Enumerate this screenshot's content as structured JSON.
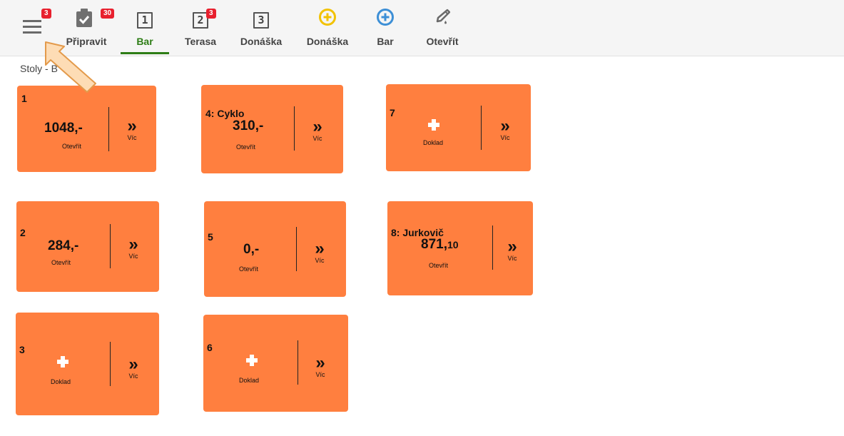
{
  "toolbar": {
    "menu_badge": "3",
    "prepare_badge": "30",
    "prepare_label": "Připravit",
    "tab1_num": "1",
    "tab1_label": "Bar",
    "tab2_num": "2",
    "tab2_badge": "3",
    "tab2_label": "Terasa",
    "tab3_num": "3",
    "tab3_label": "Donáška",
    "add_delivery_label": "Donáška",
    "add_bar_label": "Bar",
    "open_label": "Otevřít",
    "active_color": "#2e7d16"
  },
  "breadcrumb": "Stoly - B",
  "tables": {
    "t1": {
      "title": "1",
      "amount": "1048,-",
      "status": "Otevřít",
      "more": "Víc"
    },
    "t4": {
      "title": "4: Cyklo",
      "amount": "310,-",
      "status": "Otevřít",
      "more": "Víc"
    },
    "t7": {
      "title": "7",
      "status": "Doklad",
      "more": "Víc"
    },
    "t2": {
      "title": "2",
      "amount": "284,-",
      "status": "Otevřít",
      "more": "Víc"
    },
    "t5": {
      "title": "5",
      "amount": "0,-",
      "status": "Otevřít",
      "more": "Víc"
    },
    "t8": {
      "title": "8: Jurkovič",
      "amount_main": "871,",
      "amount_dec": "10",
      "status": "Otevřít",
      "more": "Víc"
    },
    "t3": {
      "title": "3",
      "status": "Doklad",
      "more": "Víc"
    },
    "t6": {
      "title": "6",
      "status": "Doklad",
      "more": "Víc"
    }
  },
  "chevron": "»",
  "colors": {
    "card": "#ff7f3f",
    "badge": "#e8202e",
    "yellow_icon": "#f2c200",
    "blue_icon": "#3d8fd6"
  }
}
